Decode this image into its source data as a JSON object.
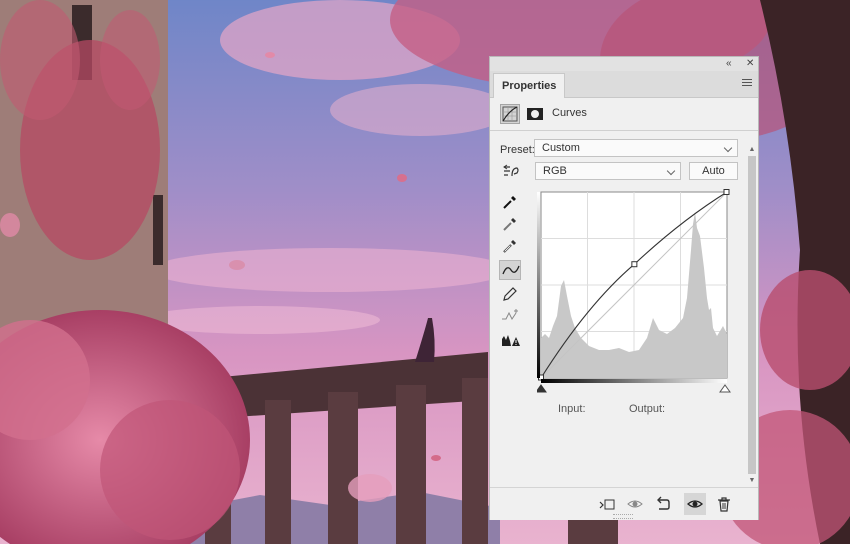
{
  "panel": {
    "collapse_glyph": "«",
    "close_glyph": "✕",
    "tab_label": "Properties",
    "menu_icon": "hamburger-menu-icon",
    "adjustment_title": "Curves",
    "preset_label": "Preset:",
    "preset_value": "Custom",
    "channel_value": "RGB",
    "auto_label": "Auto",
    "input_label": "Input:",
    "output_label": "Output:",
    "curve_points": [
      [
        0,
        0
      ],
      [
        128,
        156
      ],
      [
        255,
        255
      ]
    ],
    "tools": [
      "on-image-adjust-icon",
      "sample-black-point-icon",
      "sample-gray-point-icon",
      "sample-white-point-icon",
      "edit-points-curve-icon",
      "draw-pencil-icon",
      "smooth-curve-icon",
      "clipping-warning-icon"
    ],
    "footer_icons": [
      "clip-to-layer-icon",
      "view-previous-state-icon",
      "reset-adjustments-icon",
      "toggle-visibility-icon",
      "delete-adjustment-icon"
    ]
  },
  "colors": {
    "panel_bg": "#f0f0f0",
    "curve_line": "#333333",
    "histogram": "#c8c8c8"
  }
}
